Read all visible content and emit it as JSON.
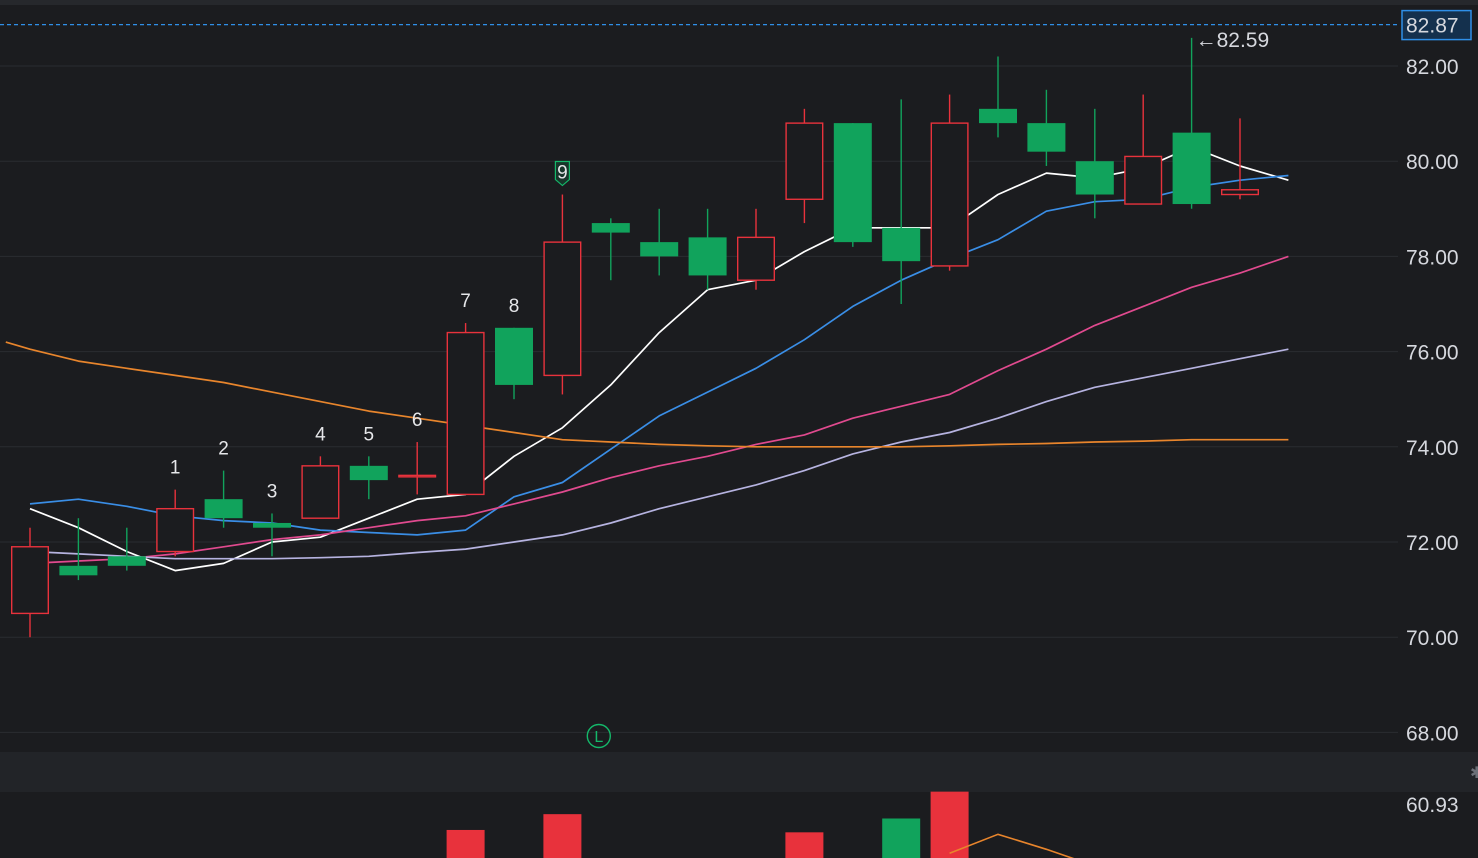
{
  "chart_data": {
    "type": "candlestick",
    "price_axis": {
      "ticks": [
        "82.00",
        "80.00",
        "78.00",
        "76.00",
        "74.00",
        "72.00",
        "70.00",
        "68.00"
      ],
      "ylim": [
        67.5,
        83.4
      ],
      "current_price_label": "82.87",
      "current_price": 82.87
    },
    "high_marker": {
      "label": "←82.59",
      "value": 82.59,
      "bar": 24
    },
    "candles": [
      {
        "o": 70.5,
        "h": 72.3,
        "l": 70.0,
        "c": 71.9
      },
      {
        "o": 71.5,
        "h": 72.5,
        "l": 71.2,
        "c": 71.3
      },
      {
        "o": 71.7,
        "h": 72.3,
        "l": 71.4,
        "c": 71.5
      },
      {
        "o": 71.8,
        "h": 73.1,
        "l": 71.7,
        "c": 72.7
      },
      {
        "o": 72.9,
        "h": 73.5,
        "l": 72.3,
        "c": 72.5
      },
      {
        "o": 72.4,
        "h": 72.6,
        "l": 71.7,
        "c": 72.3
      },
      {
        "o": 72.5,
        "h": 73.8,
        "l": 72.5,
        "c": 73.6
      },
      {
        "o": 73.6,
        "h": 73.8,
        "l": 72.9,
        "c": 73.3
      },
      {
        "o": 73.4,
        "h": 74.1,
        "l": 73.0,
        "c": 73.4
      },
      {
        "o": 73.0,
        "h": 76.6,
        "l": 73.0,
        "c": 76.4
      },
      {
        "o": 76.5,
        "h": 76.5,
        "l": 75.0,
        "c": 75.3
      },
      {
        "o": 75.5,
        "h": 79.3,
        "l": 75.1,
        "c": 78.3
      },
      {
        "o": 78.7,
        "h": 78.8,
        "l": 77.5,
        "c": 78.5
      },
      {
        "o": 78.3,
        "h": 79.0,
        "l": 77.6,
        "c": 78.0
      },
      {
        "o": 78.4,
        "h": 79.0,
        "l": 77.3,
        "c": 77.6
      },
      {
        "o": 77.5,
        "h": 79.0,
        "l": 77.3,
        "c": 78.4
      },
      {
        "o": 79.2,
        "h": 81.1,
        "l": 78.7,
        "c": 80.8
      },
      {
        "o": 80.8,
        "h": 80.8,
        "l": 78.2,
        "c": 78.3
      },
      {
        "o": 78.6,
        "h": 81.3,
        "l": 77.0,
        "c": 77.9
      },
      {
        "o": 77.8,
        "h": 81.4,
        "l": 77.7,
        "c": 80.8
      },
      {
        "o": 81.1,
        "h": 82.2,
        "l": 80.5,
        "c": 80.8
      },
      {
        "o": 80.8,
        "h": 81.5,
        "l": 79.9,
        "c": 80.2
      },
      {
        "o": 80.0,
        "h": 81.1,
        "l": 78.8,
        "c": 79.3
      },
      {
        "o": 79.1,
        "h": 81.4,
        "l": 79.1,
        "c": 80.1
      },
      {
        "o": 80.6,
        "h": 82.59,
        "l": 79.0,
        "c": 79.1
      },
      {
        "o": 79.3,
        "h": 80.9,
        "l": 79.2,
        "c": 79.4
      }
    ],
    "bar_x_start": 30,
    "bar_x_step": 48.4,
    "sequence_labels": [
      {
        "bar": 3,
        "text": "1"
      },
      {
        "bar": 4,
        "text": "2"
      },
      {
        "bar": 5,
        "text": "3"
      },
      {
        "bar": 6,
        "text": "4"
      },
      {
        "bar": 7,
        "text": "5"
      },
      {
        "bar": 8,
        "text": "6"
      },
      {
        "bar": 9,
        "text": "7"
      },
      {
        "bar": 10,
        "text": "8"
      },
      {
        "bar": 11,
        "text": "9",
        "boxed": true
      }
    ],
    "marker_L": {
      "text": "L",
      "bar": 12
    },
    "moving_averages": [
      {
        "color": "#ffffff",
        "points": [
          [
            0,
            72.7
          ],
          [
            1,
            72.3
          ],
          [
            2,
            71.8
          ],
          [
            3,
            71.4
          ],
          [
            4,
            71.55
          ],
          [
            5,
            72.0
          ],
          [
            6,
            72.1
          ],
          [
            7,
            72.5
          ],
          [
            8,
            72.9
          ],
          [
            9,
            73.0
          ],
          [
            10,
            73.8
          ],
          [
            11,
            74.4
          ],
          [
            12,
            75.3
          ],
          [
            13,
            76.4
          ],
          [
            14,
            77.3
          ],
          [
            15,
            77.5
          ],
          [
            16,
            78.1
          ],
          [
            17,
            78.6
          ],
          [
            18,
            78.6
          ],
          [
            19,
            78.6
          ],
          [
            20,
            79.3
          ],
          [
            21,
            79.75
          ],
          [
            22,
            79.65
          ],
          [
            23,
            79.85
          ],
          [
            24,
            80.3
          ],
          [
            25,
            79.9
          ],
          [
            26,
            79.6
          ]
        ]
      },
      {
        "color": "#3a8ee6",
        "points": [
          [
            0,
            72.8
          ],
          [
            1,
            72.9
          ],
          [
            2,
            72.75
          ],
          [
            3,
            72.55
          ],
          [
            4,
            72.45
          ],
          [
            5,
            72.4
          ],
          [
            6,
            72.25
          ],
          [
            7,
            72.2
          ],
          [
            8,
            72.15
          ],
          [
            9,
            72.25
          ],
          [
            10,
            72.95
          ],
          [
            11,
            73.25
          ],
          [
            12,
            73.95
          ],
          [
            13,
            74.65
          ],
          [
            14,
            75.15
          ],
          [
            15,
            75.65
          ],
          [
            16,
            76.25
          ],
          [
            17,
            76.95
          ],
          [
            18,
            77.5
          ],
          [
            19,
            77.95
          ],
          [
            20,
            78.35
          ],
          [
            21,
            78.95
          ],
          [
            22,
            79.15
          ],
          [
            23,
            79.2
          ],
          [
            24,
            79.45
          ],
          [
            25,
            79.6
          ],
          [
            26,
            79.7
          ]
        ]
      },
      {
        "color": "#e14a8f",
        "points": [
          [
            0,
            71.55
          ],
          [
            1,
            71.6
          ],
          [
            2,
            71.65
          ],
          [
            3,
            71.75
          ],
          [
            4,
            71.9
          ],
          [
            5,
            72.05
          ],
          [
            6,
            72.15
          ],
          [
            7,
            72.3
          ],
          [
            8,
            72.45
          ],
          [
            9,
            72.55
          ],
          [
            10,
            72.8
          ],
          [
            11,
            73.05
          ],
          [
            12,
            73.35
          ],
          [
            13,
            73.6
          ],
          [
            14,
            73.8
          ],
          [
            15,
            74.05
          ],
          [
            16,
            74.25
          ],
          [
            17,
            74.6
          ],
          [
            18,
            74.85
          ],
          [
            19,
            75.1
          ],
          [
            20,
            75.6
          ],
          [
            21,
            76.05
          ],
          [
            22,
            76.55
          ],
          [
            23,
            76.95
          ],
          [
            24,
            77.35
          ],
          [
            25,
            77.65
          ],
          [
            26,
            78.0
          ]
        ]
      },
      {
        "color": "#b6b3e0",
        "points": [
          [
            0,
            71.8
          ],
          [
            1,
            71.75
          ],
          [
            2,
            71.7
          ],
          [
            3,
            71.65
          ],
          [
            4,
            71.65
          ],
          [
            5,
            71.65
          ],
          [
            6,
            71.67
          ],
          [
            7,
            71.7
          ],
          [
            8,
            71.78
          ],
          [
            9,
            71.85
          ],
          [
            10,
            72.0
          ],
          [
            11,
            72.15
          ],
          [
            12,
            72.4
          ],
          [
            13,
            72.7
          ],
          [
            14,
            72.95
          ],
          [
            15,
            73.2
          ],
          [
            16,
            73.5
          ],
          [
            17,
            73.85
          ],
          [
            18,
            74.1
          ],
          [
            19,
            74.3
          ],
          [
            20,
            74.6
          ],
          [
            21,
            74.95
          ],
          [
            22,
            75.25
          ],
          [
            23,
            75.45
          ],
          [
            24,
            75.65
          ],
          [
            25,
            75.85
          ],
          [
            26,
            76.05
          ]
        ]
      },
      {
        "color": "#e8852c",
        "points": [
          [
            -0.5,
            76.2
          ],
          [
            0,
            76.05
          ],
          [
            1,
            75.8
          ],
          [
            2,
            75.65
          ],
          [
            3,
            75.5
          ],
          [
            4,
            75.35
          ],
          [
            5,
            75.15
          ],
          [
            6,
            74.95
          ],
          [
            7,
            74.75
          ],
          [
            8,
            74.6
          ],
          [
            9,
            74.45
          ],
          [
            10,
            74.3
          ],
          [
            11,
            74.15
          ],
          [
            12,
            74.1
          ],
          [
            13,
            74.05
          ],
          [
            14,
            74.02
          ],
          [
            15,
            74.0
          ],
          [
            16,
            74.0
          ],
          [
            17,
            74.0
          ],
          [
            18,
            74.0
          ],
          [
            19,
            74.02
          ],
          [
            20,
            74.05
          ],
          [
            21,
            74.07
          ],
          [
            22,
            74.1
          ],
          [
            23,
            74.12
          ],
          [
            24,
            74.15
          ],
          [
            25,
            74.15
          ],
          [
            26,
            74.15
          ]
        ]
      }
    ],
    "volume": {
      "axis_label": "60.93",
      "bars": [
        {
          "bar": 9,
          "level": 0.71,
          "color": "#e8323c"
        },
        {
          "bar": 11,
          "level": 1.11,
          "color": "#e8323c"
        },
        {
          "bar": 16,
          "level": 0.65,
          "color": "#e8323c"
        },
        {
          "bar": 18,
          "level": 1.0,
          "color": "#11a35c"
        },
        {
          "bar": 19,
          "level": 1.68,
          "color": "#e8323c"
        }
      ],
      "ma": {
        "color": "#e8852c",
        "points": [
          [
            19,
            0.12
          ],
          [
            20,
            0.6
          ],
          [
            21,
            0.22
          ],
          [
            22,
            -0.2
          ]
        ]
      }
    },
    "colors": {
      "up": "#e8323c",
      "down": "#11a35c",
      "background": "#1b1c1f",
      "grid": "#2a2c31",
      "price_line": "#2f8fe8"
    }
  }
}
